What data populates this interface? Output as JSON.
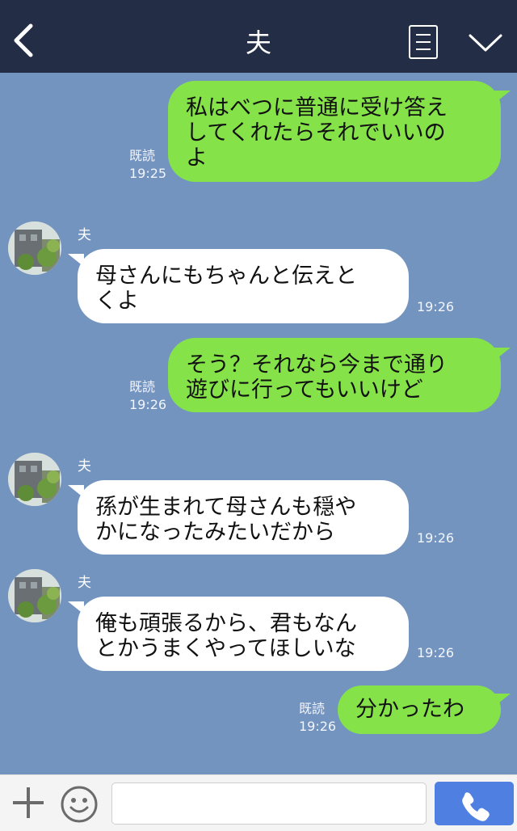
{
  "header": {
    "title": "夫",
    "back_icon": "chevron-left-icon",
    "menu_icon": "list-icon",
    "collapse_icon": "chevron-down-icon",
    "background": "#232d45"
  },
  "chat": {
    "background": "#7494c0",
    "mine_bubble_color": "#85e249",
    "theirs_bubble_color": "#ffffff",
    "messages": [
      {
        "from": "me",
        "lines": [
          "私はべつに普通に受け答え",
          "してくれたらそれでいいの",
          "よ"
        ],
        "read": "既読",
        "time": "19:25"
      },
      {
        "from": "夫",
        "lines": [
          "母さんにもちゃんと伝えと",
          "くよ"
        ],
        "time": "19:26"
      },
      {
        "from": "me",
        "lines": [
          "そう？それなら今まで通り",
          "遊びに行ってもいいけど"
        ],
        "read": "既読",
        "time": "19:26"
      },
      {
        "from": "夫",
        "lines": [
          "孫が生まれて母さんも穏や",
          "かになったみたいだから"
        ],
        "time": "19:26"
      },
      {
        "from": "夫",
        "lines": [
          "俺も頑張るから、君もなん",
          "とかうまくやってほしいな"
        ],
        "time": "19:26"
      },
      {
        "from": "me",
        "lines": [
          "分かったわ"
        ],
        "read": "既読",
        "time": "19:26"
      }
    ]
  },
  "inputbar": {
    "plus_icon": "plus-icon",
    "emoji_icon": "smiley-icon",
    "text_value": "",
    "call_icon": "phone-icon",
    "call_button_color": "#4f7fe0"
  }
}
